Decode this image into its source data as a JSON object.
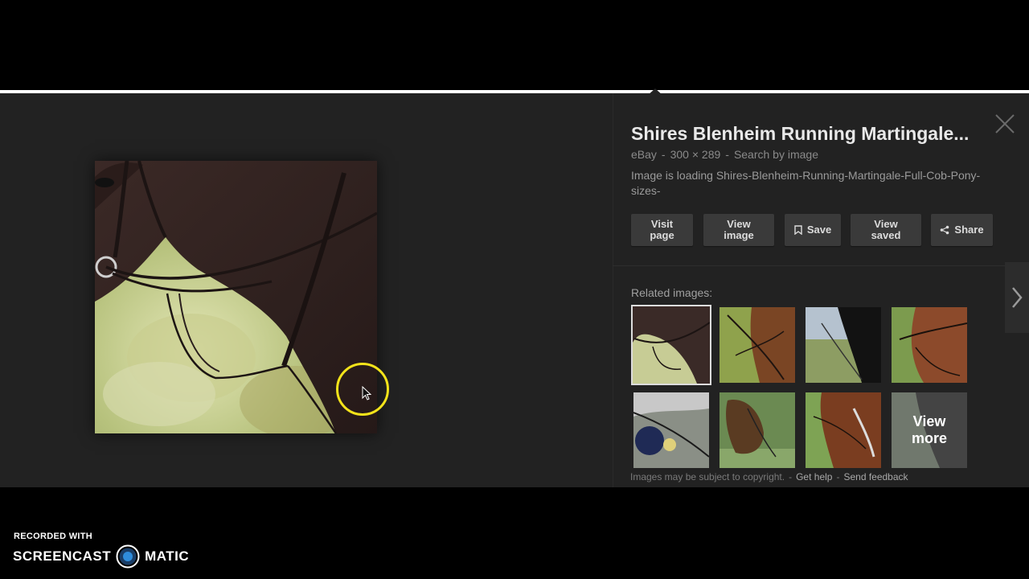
{
  "details": {
    "title": "Shires Blenheim Running Martingale...",
    "source": "eBay",
    "dimensions": "300 × 289",
    "search_by_image": "Search by image",
    "description": "Image is loading Shires-Blenheim-Running-Martingale-Full-Cob-Pony-sizes-"
  },
  "buttons": {
    "visit_page": "Visit page",
    "view_image": "View image",
    "save": "Save",
    "view_saved": "View saved",
    "share": "Share"
  },
  "related": {
    "label": "Related images:",
    "view_more": "View more"
  },
  "footer": {
    "copyright": "Images may be subject to copyright.",
    "get_help": "Get help",
    "send_feedback": "Send feedback"
  },
  "watermark": {
    "recorded_with": "RECORDED WITH",
    "brand_left": "SCREENCAST",
    "brand_right": "MATIC"
  },
  "icons": [
    "close-icon",
    "bookmark-icon",
    "share-icon",
    "chevron-right-icon",
    "mouse-cursor-icon",
    "screencast-logo-icon"
  ]
}
